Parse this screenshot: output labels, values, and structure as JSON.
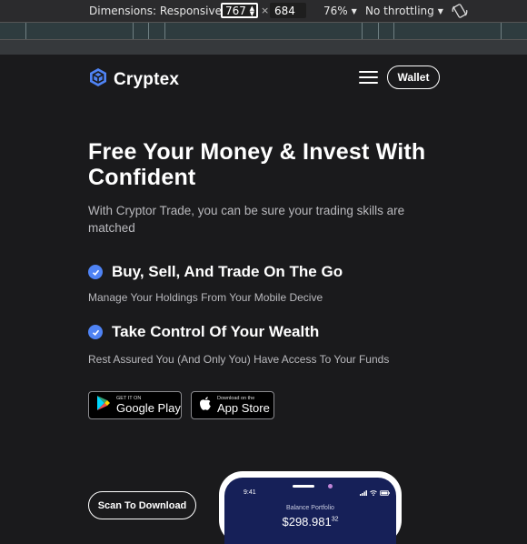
{
  "devtools": {
    "dimensions_label": "Dimensions: Responsive",
    "width": "767",
    "times": "×",
    "height": "684",
    "zoom": "76%",
    "throttling": "No throttling",
    "icons": [
      "chevron-down-icon",
      "spinner-arrows-icon",
      "rotate-icon"
    ]
  },
  "header": {
    "brand": "Cryptex",
    "wallet_label": "Wallet",
    "icons": [
      "cube-logo-icon",
      "hamburger-menu-icon"
    ]
  },
  "hero": {
    "title": "Free Your Money & Invest With Confident",
    "subtitle": "With Cryptor Trade, you can be sure your trading skills are matched"
  },
  "features": [
    {
      "title": "Buy, Sell, And Trade On The Go",
      "description": "Manage Your Holdings From Your Mobile Decive"
    },
    {
      "title": "Take Control Of Your Wealth",
      "description": "Rest Assured You (And Only You) Have Access To Your Funds"
    }
  ],
  "stores": {
    "google": {
      "small": "GET IT ON",
      "big": "Google Play"
    },
    "apple": {
      "small": "Download on the",
      "big": "App Store"
    }
  },
  "scan_label": "Scan To Download",
  "phone": {
    "time": "9:41",
    "balance_label": "Balance Portfolio",
    "balance_main": "$298.981",
    "balance_cents": "32"
  },
  "colors": {
    "accent": "#4f83f4",
    "background": "#1a1a1c",
    "phone_screen": "#162058"
  }
}
